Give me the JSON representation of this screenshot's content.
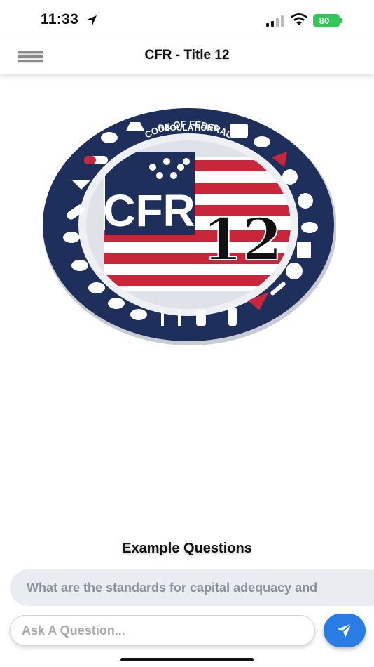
{
  "status_bar": {
    "time": "11:33",
    "battery": "80"
  },
  "header": {
    "title": "CFR - Title 12",
    "menu_icon": "hamburger-icon"
  },
  "emblem": {
    "ring_text": "CODE OF FEDERAL REGULATIONS",
    "center_text": "CFR",
    "title_number": "12",
    "colors": {
      "navy": "#1d2f5a",
      "red": "#c8263a",
      "white": "#ffffff"
    }
  },
  "examples": {
    "heading": "Example Questions",
    "items": [
      "What are the standards for capital adequacy and"
    ]
  },
  "composer": {
    "placeholder": "Ask A Question...",
    "value": "",
    "send_icon": "send-icon"
  },
  "colors": {
    "accent": "#2b7de6",
    "chip_bg": "#e9ecf1",
    "battery": "#33c759"
  }
}
